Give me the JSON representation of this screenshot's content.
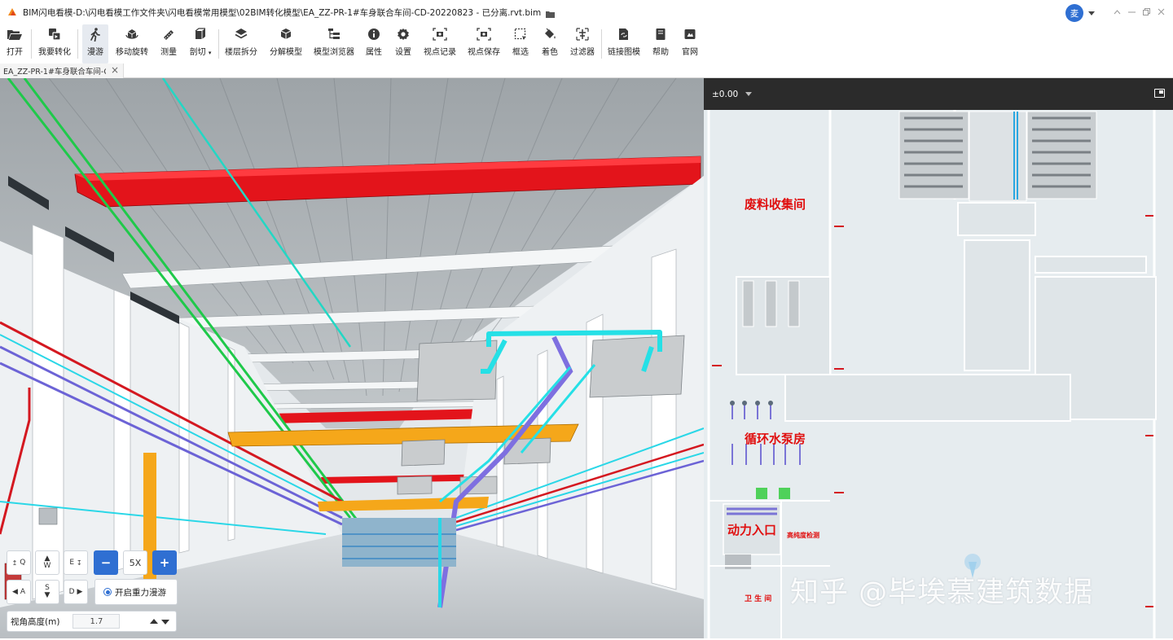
{
  "window": {
    "title": "BIM闪电看模-D:\\闪电看模工作文件夹\\闪电看模常用模型\\02BIM转化模型\\EA_ZZ-PR-1#车身联合车间-CD-20220823 - 已分离.rvt.bim",
    "user_avatar": "麦"
  },
  "toolbar": {
    "items": [
      {
        "label": "打开",
        "icon": "folder-open-icon"
      },
      {
        "label": "我要转化",
        "icon": "convert-icon"
      },
      {
        "label": "漫游",
        "icon": "walk-icon"
      },
      {
        "label": "移动旋转",
        "icon": "rotate-icon"
      },
      {
        "label": "测量",
        "icon": "ruler-icon"
      },
      {
        "label": "剖切",
        "icon": "section-box-icon"
      },
      {
        "label": "楼层拆分",
        "icon": "layers-icon"
      },
      {
        "label": "分解模型",
        "icon": "explode-icon"
      },
      {
        "label": "模型浏览器",
        "icon": "tree-icon"
      },
      {
        "label": "属性",
        "icon": "info-icon"
      },
      {
        "label": "设置",
        "icon": "gear-icon"
      },
      {
        "label": "视点记录",
        "icon": "viewpoint-record-icon"
      },
      {
        "label": "视点保存",
        "icon": "viewpoint-save-icon"
      },
      {
        "label": "框选",
        "icon": "box-select-icon"
      },
      {
        "label": "着色",
        "icon": "paint-bucket-icon"
      },
      {
        "label": "过滤器",
        "icon": "filter-icon"
      },
      {
        "label": "链接图模",
        "icon": "link-model-icon"
      },
      {
        "label": "帮助",
        "icon": "help-book-icon"
      },
      {
        "label": "官网",
        "icon": "website-icon"
      }
    ]
  },
  "tabs": {
    "active_doc": "EA_ZZ-PR-1#车身联合车间-C..."
  },
  "navigation": {
    "keys": {
      "q": "Q",
      "w": "W",
      "e": "E",
      "a": "A",
      "s": "S",
      "d": "D"
    },
    "zoom_out": "−",
    "speed": "5X",
    "zoom_in": "+",
    "gravity_label": "开启重力漫游",
    "gravity_on": true,
    "height_label": "视角高度(m)",
    "height_value": "1.7"
  },
  "minimap": {
    "level": "±0.00",
    "rooms": {
      "waste": "废料收集间",
      "pump": "循环水泵房",
      "power": "动力入口",
      "hv": "高纯度检测",
      "wc": "卫 生 间"
    }
  },
  "watermark": "知乎 @毕埃慕建筑数据",
  "colors": {
    "accent": "#2f6fd2",
    "room_label": "#e00f0f",
    "minimap_header": "#2b2b2b"
  }
}
